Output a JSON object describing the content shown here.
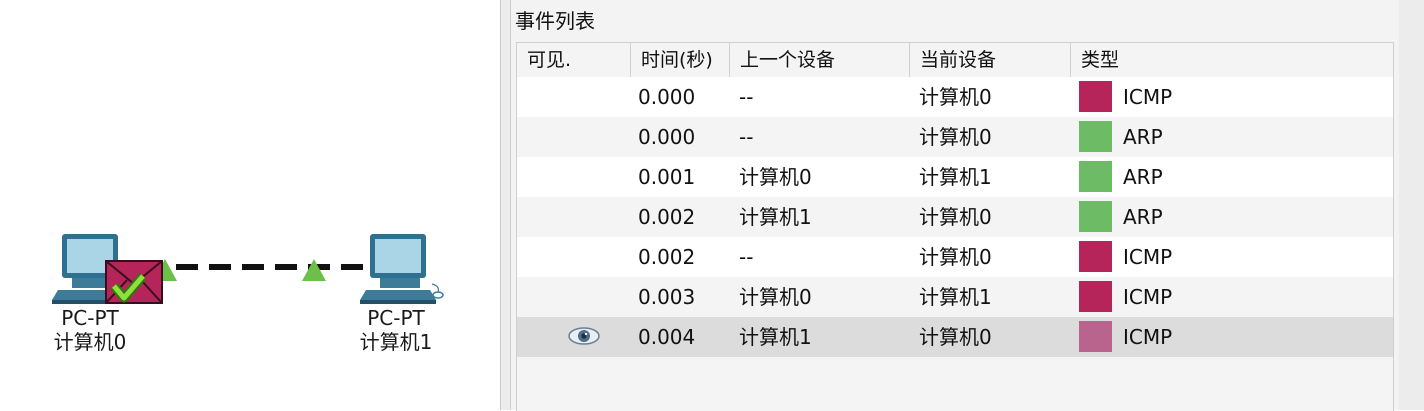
{
  "topology": {
    "devices": [
      {
        "type": "PC-PT",
        "name": "计算机0"
      },
      {
        "type": "PC-PT",
        "name": "计算机1"
      }
    ],
    "link_marker_color": "#6cc04a",
    "envelope_color": "#b5255a",
    "check_color": "#7ed321"
  },
  "event_list": {
    "title": "事件列表",
    "columns": [
      "可见.",
      "时间(秒)",
      "上一个设备",
      "当前设备",
      "类型"
    ],
    "rows": [
      {
        "visible": "",
        "time": "0.000",
        "last": "--",
        "at": "计算机0",
        "type": "ICMP",
        "color": "#b5255a"
      },
      {
        "visible": "",
        "time": "0.000",
        "last": "--",
        "at": "计算机0",
        "type": "ARP",
        "color": "#6dbb64"
      },
      {
        "visible": "",
        "time": "0.001",
        "last": "计算机0",
        "at": "计算机1",
        "type": "ARP",
        "color": "#6dbb64"
      },
      {
        "visible": "",
        "time": "0.002",
        "last": "计算机1",
        "at": "计算机0",
        "type": "ARP",
        "color": "#6dbb64"
      },
      {
        "visible": "",
        "time": "0.002",
        "last": "--",
        "at": "计算机0",
        "type": "ICMP",
        "color": "#b5255a"
      },
      {
        "visible": "",
        "time": "0.003",
        "last": "计算机0",
        "at": "计算机1",
        "type": "ICMP",
        "color": "#b5255a"
      },
      {
        "visible": "eye-icon",
        "time": "0.004",
        "last": "计算机1",
        "at": "计算机0",
        "type": "ICMP",
        "color": "#b8648d",
        "selected": true
      }
    ]
  }
}
